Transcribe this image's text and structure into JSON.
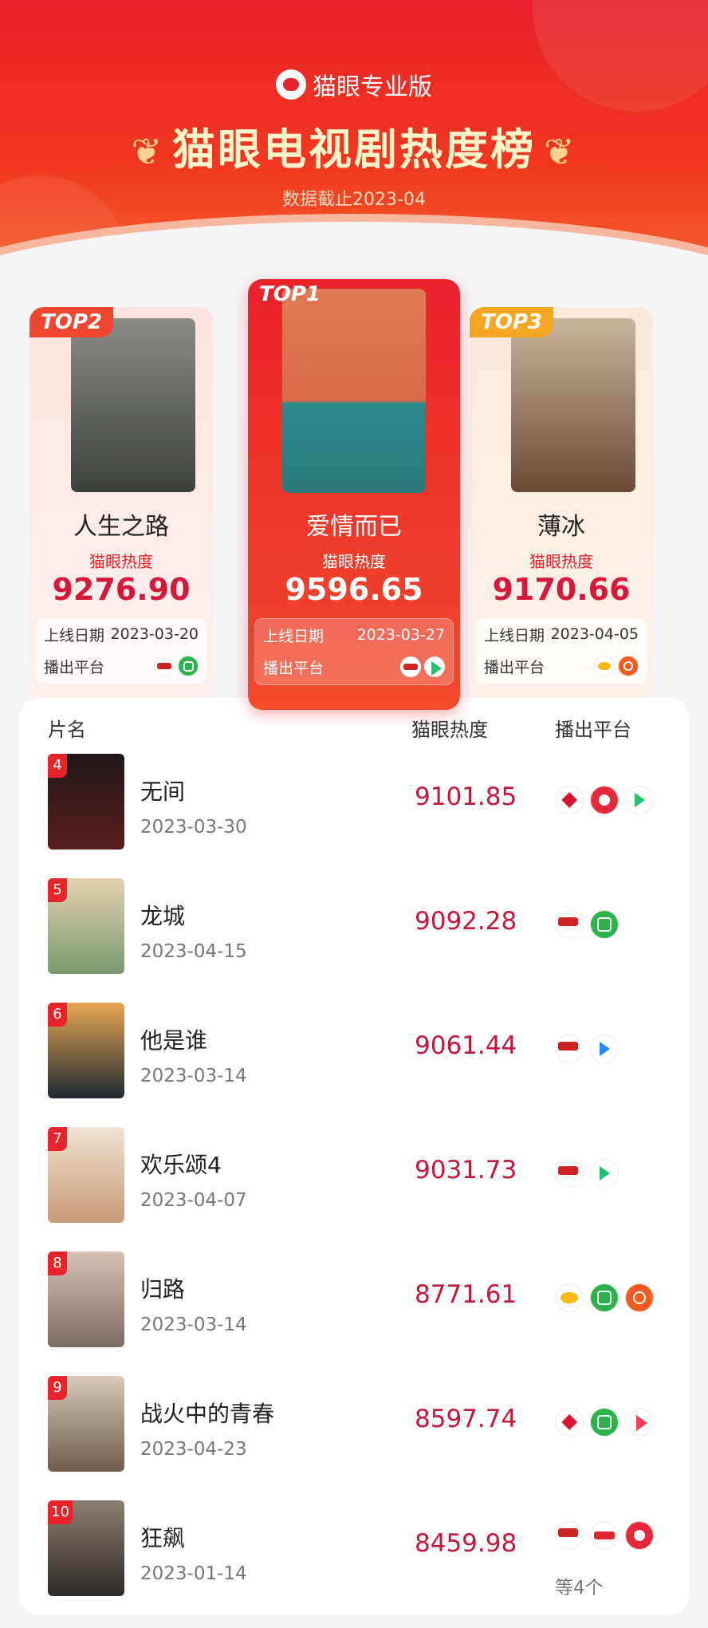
{
  "header": {
    "brand": "猫眼专业版",
    "title": "猫眼电视剧热度榜",
    "subtitle": "数据截止2023-04"
  },
  "labels": {
    "heat": "猫眼热度",
    "release": "上线日期",
    "platform": "播出平台"
  },
  "top": [
    {
      "badge": "TOP2",
      "name": "人生之路",
      "heat": "9276.90",
      "date": "2023-03-20",
      "platforms": [
        "cctv-icon",
        "iqiyi-icon"
      ],
      "poster_color": "#4a4d4a"
    },
    {
      "badge": "TOP1",
      "name": "爱情而已",
      "heat": "9596.65",
      "date": "2023-03-27",
      "platforms": [
        "cctv-icon",
        "tencent-video-icon"
      ],
      "poster_color": "#d66a4c"
    },
    {
      "badge": "TOP3",
      "name": "薄冰",
      "heat": "9170.66",
      "date": "2023-04-05",
      "platforms": [
        "hunan-tv-icon",
        "mgtv-icon"
      ],
      "poster_color": "#7a5a45"
    }
  ],
  "list": {
    "headers": {
      "name": "片名",
      "heat": "猫眼热度",
      "platform": "播出平台"
    },
    "rows": [
      {
        "rank": "4",
        "name": "无间",
        "date": "2023-03-30",
        "heat": "9101.85",
        "platforms": [
          "dragon-tv-icon",
          "jiangsu-tv-icon",
          "tencent-video-icon"
        ],
        "more": "",
        "thumb": "#2b1e22"
      },
      {
        "rank": "5",
        "name": "龙城",
        "date": "2023-04-15",
        "heat": "9092.28",
        "platforms": [
          "cctv-icon",
          "iqiyi-icon"
        ],
        "more": "",
        "thumb": "#c9b48a"
      },
      {
        "rank": "6",
        "name": "他是谁",
        "date": "2023-03-14",
        "heat": "9061.44",
        "platforms": [
          "cctv-icon",
          "youku-icon"
        ],
        "more": "",
        "thumb": "#3c4a55"
      },
      {
        "rank": "7",
        "name": "欢乐颂4",
        "date": "2023-04-07",
        "heat": "9031.73",
        "platforms": [
          "cctv-icon",
          "tencent-video-icon"
        ],
        "more": "",
        "thumb": "#d9c7b5"
      },
      {
        "rank": "8",
        "name": "归路",
        "date": "2023-03-14",
        "heat": "8771.61",
        "platforms": [
          "hunan-tv-icon",
          "iqiyi-icon",
          "mgtv-icon"
        ],
        "more": "",
        "thumb": "#b79e92"
      },
      {
        "rank": "9",
        "name": "战火中的青春",
        "date": "2023-04-23",
        "heat": "8597.74",
        "platforms": [
          "dragon-tv-icon",
          "iqiyi-icon",
          "youku-icon"
        ],
        "more": "",
        "thumb": "#a98f7a"
      },
      {
        "rank": "10",
        "name": "狂飙",
        "date": "2023-01-14",
        "heat": "8459.98",
        "platforms": [
          "cctv-icon",
          "migu-icon",
          "jiangsu-tv-icon"
        ],
        "more": "等4个",
        "thumb": "#4b4641"
      }
    ]
  }
}
